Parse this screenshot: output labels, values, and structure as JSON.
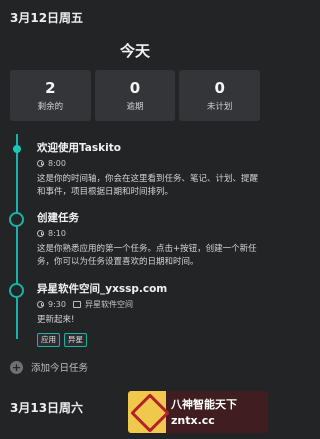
{
  "date_header_1": "3月12日周五",
  "today_title": "今天",
  "stats": [
    {
      "value": "2",
      "label": "剩余的"
    },
    {
      "value": "0",
      "label": "逾期"
    },
    {
      "value": "0",
      "label": "未计划"
    }
  ],
  "tasks": [
    {
      "title": "欢迎使用Taskito",
      "time": "8:00",
      "description": "这是你的时间轴，你会在这里看到任务、笔记、计划、提醒和事件，项目根据日期和时间排列。"
    },
    {
      "title": "创建任务",
      "time": "8:10",
      "description": "这是你熟悉应用的第一个任务。点击+按钮，创建一个新任务，你可以为任务设置喜欢的日期和时间。"
    },
    {
      "title": "异星软件空间_yxssp.com",
      "time": "9:30",
      "project": "异星软件空间",
      "description": "更新起来!",
      "tags": [
        "应用",
        "异星"
      ]
    }
  ],
  "add_today_label": "添加今日任务",
  "date_header_2": "3月13日周六",
  "watermark": {
    "line1": "八神智能天下",
    "line2": "zntx.cc"
  },
  "colors": {
    "accent": "#19b3a6",
    "background": "#222426",
    "card": "#333538"
  },
  "icons": [
    "clock-icon",
    "project-icon",
    "plus-icon"
  ]
}
